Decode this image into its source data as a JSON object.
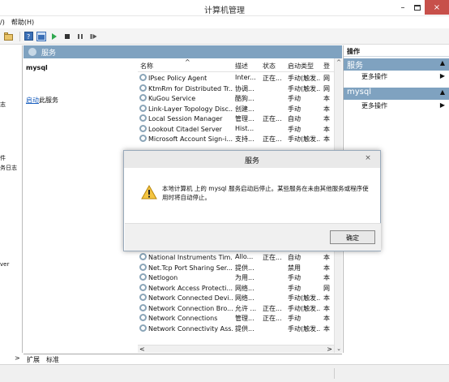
{
  "window": {
    "title": "计算机管理",
    "controls": {
      "minimize": "–",
      "maximize": "",
      "close": "×"
    }
  },
  "menubar": {
    "items": [
      "/)",
      "帮助(H)"
    ]
  },
  "toolbar": {
    "buttons": [
      "folder-icon",
      "help-icon",
      "properties-icon",
      "play-icon",
      "stop-icon",
      "pause-icon",
      "restart-icon"
    ]
  },
  "leftpane": {
    "fragments": [
      "志",
      "件",
      "务日志",
      "ver"
    ]
  },
  "services_header": "服务",
  "description": {
    "name": "mysql",
    "link_text": "启动",
    "link_suffix": "此服务"
  },
  "list": {
    "columns": {
      "name": "名称",
      "desc": "描述",
      "status": "状态",
      "startup": "启动类型",
      "login": "登"
    },
    "rows": [
      {
        "name": "IPsec Policy Agent",
        "desc": "Inter...",
        "status": "正在...",
        "startup": "手动(触发...",
        "login": "网"
      },
      {
        "name": "KtmRm for Distributed Tr...",
        "desc": "协调...",
        "status": "",
        "startup": "手动(触发...",
        "login": "网"
      },
      {
        "name": "KuGou Service",
        "desc": "酷狗...",
        "status": "",
        "startup": "手动",
        "login": "本"
      },
      {
        "name": "Link-Layer Topology Disc...",
        "desc": "创建...",
        "status": "",
        "startup": "手动",
        "login": "本"
      },
      {
        "name": "Local Session Manager",
        "desc": "管理...",
        "status": "正在...",
        "startup": "自动",
        "login": "本"
      },
      {
        "name": "Lookout Citadel Server",
        "desc": "Hist...",
        "status": "",
        "startup": "手动",
        "login": "本"
      },
      {
        "name": "Microsoft Account Sign-i...",
        "desc": "支持...",
        "status": "正在...",
        "startup": "手动(触发...",
        "login": "本"
      }
    ],
    "rows_bottom": [
      {
        "name": "National Instruments Tim...",
        "desc": "Allo...",
        "status": "正在...",
        "startup": "自动",
        "login": "本"
      },
      {
        "name": "Net.Tcp Port Sharing Ser...",
        "desc": "提供...",
        "status": "",
        "startup": "禁用",
        "login": "本"
      },
      {
        "name": "Netlogon",
        "desc": "为用...",
        "status": "",
        "startup": "手动",
        "login": "本"
      },
      {
        "name": "Network Access Protecti...",
        "desc": "网络...",
        "status": "",
        "startup": "手动",
        "login": "网"
      },
      {
        "name": "Network Connected Devi...",
        "desc": "网络...",
        "status": "",
        "startup": "手动(触发...",
        "login": "本"
      },
      {
        "name": "Network Connection Bro...",
        "desc": "允许 ...",
        "status": "正在...",
        "startup": "手动(触发...",
        "login": "本"
      },
      {
        "name": "Network Connections",
        "desc": "管理...",
        "status": "正在...",
        "startup": "手动",
        "login": "本"
      },
      {
        "name": "Network Connectivity Ass...",
        "desc": "提供...",
        "status": "",
        "startup": "手动(触发...",
        "login": "本"
      }
    ],
    "scroll": {
      "up": "^",
      "down": "⌄",
      "left": "<",
      "right": ">"
    }
  },
  "tabs": [
    "扩展",
    "标准"
  ],
  "leftnav": {
    "right_arrow": ">"
  },
  "actions": {
    "header": "操作",
    "sections": [
      {
        "title": "服务",
        "arrow": "▲",
        "item": "更多操作",
        "item_arrow": "▶"
      },
      {
        "title": "mysql",
        "arrow": "▲",
        "item": "更多操作",
        "item_arrow": "▶"
      }
    ]
  },
  "dialog": {
    "title": "服务",
    "close": "×",
    "message": "本地计算机 上的 mysql 服务启动后停止。某些服务在未由其他服务或程序使用时将自动停止。",
    "ok": "确定"
  }
}
